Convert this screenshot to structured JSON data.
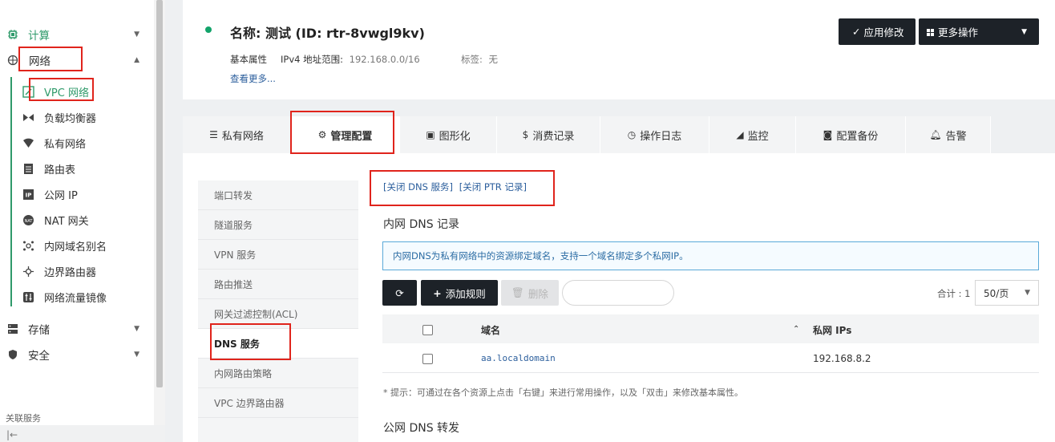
{
  "sidebar": {
    "groups": {
      "compute": "计算",
      "network": "网络",
      "storage": "存储",
      "security": "安全"
    },
    "network_items": [
      "VPC 网络",
      "负载均衡器",
      "私有网络",
      "路由表",
      "公网 IP",
      "NAT 网关",
      "内网域名别名",
      "边界路由器",
      "网络流量镜像"
    ],
    "related": "关联服务"
  },
  "header": {
    "title": "名称: 测试 (ID: rtr-8vwgl9kv)",
    "basic_label": "基本属性",
    "ipv4_label": "IPv4 地址范围:",
    "ipv4_value": "192.168.0.0/16",
    "tag_label": "标签:",
    "tag_value": "无",
    "see_more": "查看更多...",
    "apply_btn": "应用修改",
    "more_btn": "更多操作"
  },
  "tabs": [
    "私有网络",
    "管理配置",
    "图形化",
    "消费记录",
    "操作日志",
    "监控",
    "配置备份",
    "告警"
  ],
  "subnav": [
    "端口转发",
    "隧道服务",
    "VPN 服务",
    "路由推送",
    "网关过滤控制(ACL)",
    "DNS 服务",
    "内网路由策略",
    "VPC 边界路由器"
  ],
  "dns": {
    "close_dns": "[关闭 DNS 服务]",
    "close_ptr": "[关闭 PTR 记录]",
    "internal_title": "内网 DNS 记录",
    "info": "内网DNS为私有网络中的资源绑定域名，支持一个域名绑定多个私网IP。",
    "add_rule": "添加规则",
    "delete": "删除",
    "total": "合计 : 1",
    "page_size": "50/页",
    "columns": {
      "domain": "域名",
      "ips": "私网 IPs"
    },
    "rows": [
      {
        "domain": "aa.localdomain",
        "ips": "192.168.8.2"
      }
    ],
    "hint": "* 提示：可通过在各个资源上点击「右键」来进行常用操作，以及「双击」来修改基本属性。",
    "public_title": "公网 DNS 转发"
  },
  "colors": {
    "accent": "#2f9a6a",
    "dark_button": "#1d2228",
    "annotation": "#e0241c",
    "link": "#2b5e9c"
  }
}
